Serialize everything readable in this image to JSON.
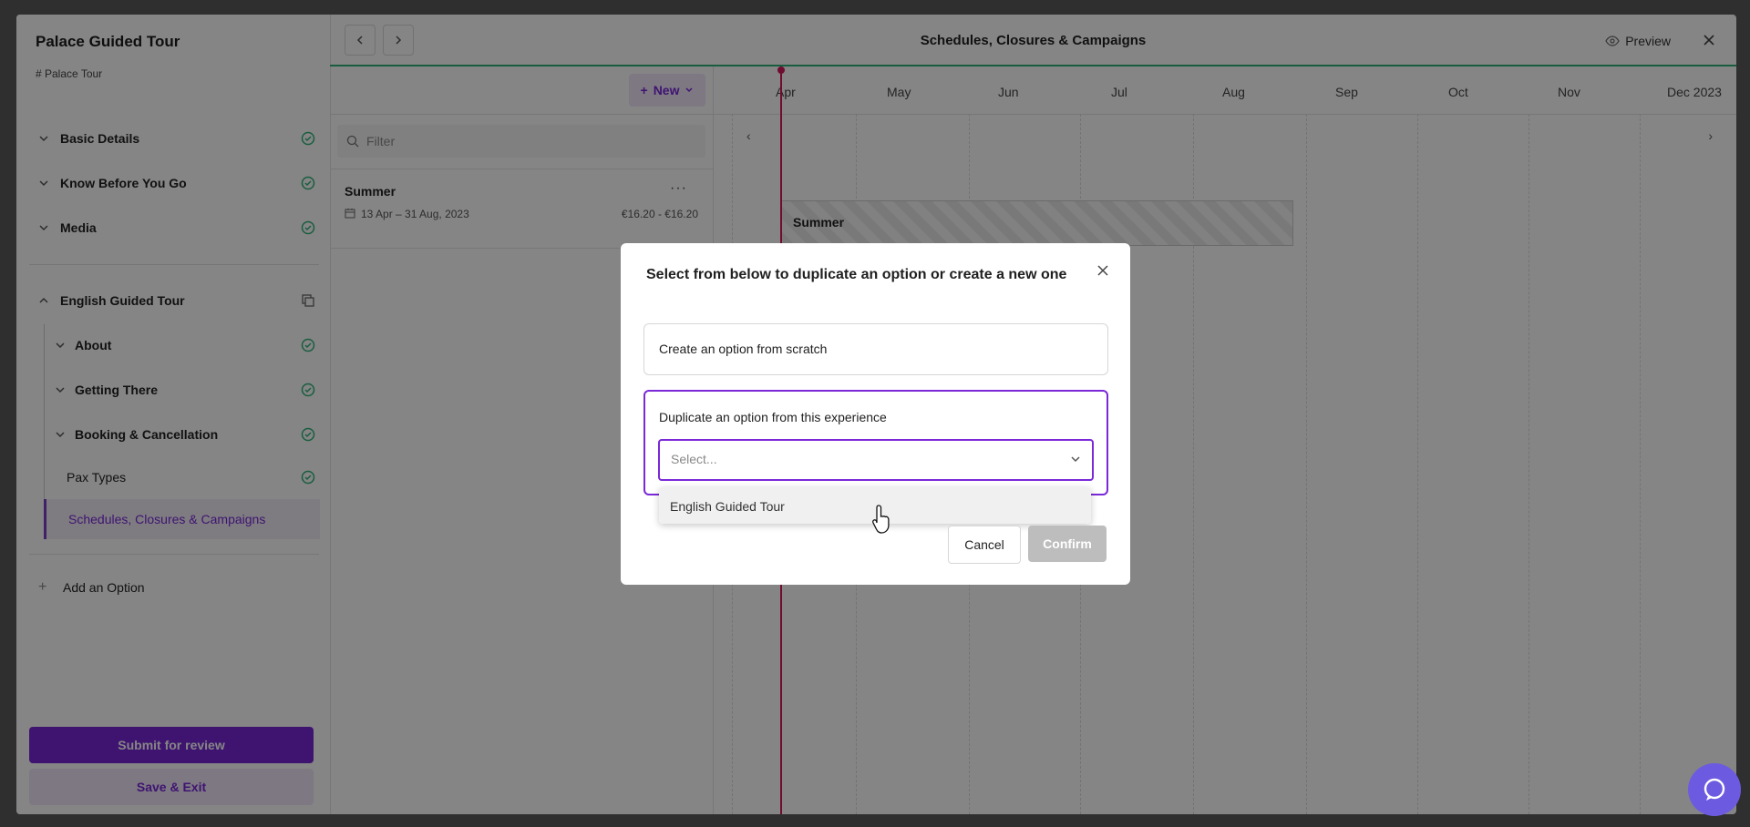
{
  "sidebar": {
    "title": "Palace Guided Tour",
    "subtitle": "# Palace Tour",
    "items": [
      {
        "label": "Basic Details"
      },
      {
        "label": "Know Before You Go"
      },
      {
        "label": "Media"
      }
    ],
    "option": {
      "label": "English Guided Tour",
      "sub_items": [
        {
          "label": "About"
        },
        {
          "label": "Getting There"
        },
        {
          "label": "Booking & Cancellation"
        },
        {
          "label": "Pax Types"
        },
        {
          "label": "Schedules, Closures & Campaigns"
        }
      ]
    },
    "add_option": "Add an Option",
    "submit": "Submit for review",
    "save_exit": "Save & Exit"
  },
  "topbar": {
    "title": "Schedules, Closures & Campaigns",
    "preview": "Preview"
  },
  "left_panel": {
    "new_label": "New",
    "filter_placeholder": "Filter",
    "schedule": {
      "name": "Summer",
      "dates": "13 Apr – 31 Aug, 2023",
      "price": "€16.20 - €16.20"
    }
  },
  "timeline": {
    "months": [
      "Apr",
      "May",
      "Jun",
      "Jul",
      "Aug",
      "Sep",
      "Oct",
      "Nov",
      "Dec 2023"
    ],
    "bar_label": "Summer"
  },
  "modal": {
    "title": "Select from below to duplicate an option or create a new one",
    "scratch": "Create an option from scratch",
    "duplicate": "Duplicate an option from this experience",
    "select_placeholder": "Select...",
    "dropdown_item": "English Guided Tour",
    "cancel": "Cancel",
    "confirm": "Confirm"
  },
  "colors": {
    "accent": "#7a28d8",
    "success": "#2fb37a",
    "today": "#d6175a",
    "chat": "#6c5be0"
  }
}
